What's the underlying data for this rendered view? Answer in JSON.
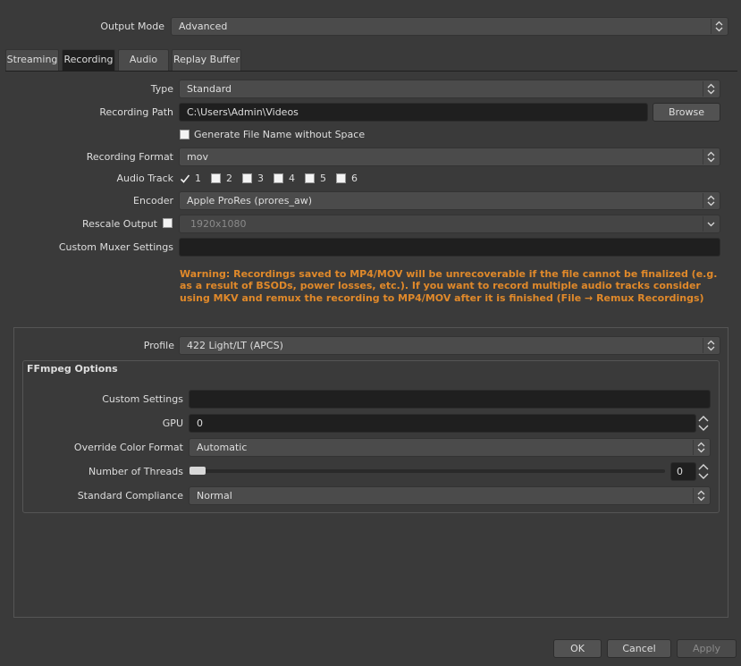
{
  "output_mode": {
    "label": "Output Mode",
    "value": "Advanced"
  },
  "tabs": [
    {
      "label": "Streaming"
    },
    {
      "label": "Recording"
    },
    {
      "label": "Audio"
    },
    {
      "label": "Replay Buffer"
    }
  ],
  "recording": {
    "type_label": "Type",
    "type_value": "Standard",
    "path_label": "Recording Path",
    "path_value": "C:\\Users\\Admin\\Videos",
    "browse_label": "Browse",
    "gen_filename_label": "Generate File Name without Space",
    "format_label": "Recording Format",
    "format_value": "mov",
    "audio_track_label": "Audio Track",
    "tracks": [
      "1",
      "2",
      "3",
      "4",
      "5",
      "6"
    ],
    "tracks_checked": [
      true,
      false,
      false,
      false,
      false,
      false
    ],
    "encoder_label": "Encoder",
    "encoder_value": "Apple ProRes (prores_aw)",
    "rescale_label": "Rescale Output",
    "rescale_value": "1920x1080",
    "muxer_label": "Custom Muxer Settings",
    "muxer_value": "",
    "warning": "Warning: Recordings saved to MP4/MOV will be unrecoverable if the file cannot be finalized (e.g. as a result of BSODs, power losses, etc.). If you want to record multiple audio tracks consider using MKV and remux the recording to MP4/MOV after it is finished (File → Remux Recordings)"
  },
  "encoder_settings": {
    "profile_label": "Profile",
    "profile_value": "422 Light/LT (APCS)",
    "ffmpeg_title": "FFmpeg Options",
    "custom_settings_label": "Custom Settings",
    "custom_settings_value": "",
    "gpu_label": "GPU",
    "gpu_value": "0",
    "color_format_label": "Override Color Format",
    "color_format_value": "Automatic",
    "threads_label": "Number of Threads",
    "threads_value": "0",
    "compliance_label": "Standard Compliance",
    "compliance_value": "Normal"
  },
  "buttons": {
    "ok": "OK",
    "cancel": "Cancel",
    "apply": "Apply"
  },
  "colors": {
    "background": "#3a3a3a",
    "warning": "#e0892a",
    "field": "#1f1f1f"
  }
}
